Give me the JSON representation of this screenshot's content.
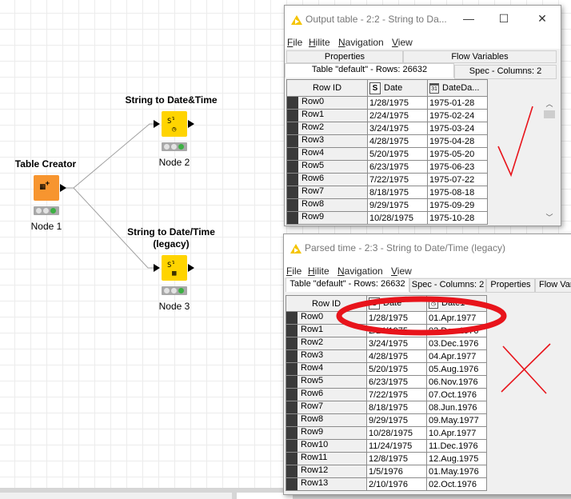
{
  "workflow": {
    "nodes": [
      {
        "id": "node1",
        "title": "Table Creator",
        "label": "Node 1",
        "color": "#f7952f",
        "icon": "table-plus-icon"
      },
      {
        "id": "node2",
        "title": "String to Date&Time",
        "label": "Node 2",
        "color": "#ffd400",
        "icon": "string-to-clock-icon"
      },
      {
        "id": "node3",
        "title_line1": "String to Date/Time",
        "title_line2": "(legacy)",
        "label": "Node 3",
        "color": "#ffd400",
        "icon": "string-to-calendar-icon"
      }
    ]
  },
  "window1": {
    "title": "Output table - 2:2 - String to Da...",
    "controls": {
      "minimize": "—",
      "maximize": "☐",
      "close": "✕"
    },
    "menu": [
      "File",
      "Hilite",
      "Navigation",
      "View"
    ],
    "tabs_row1": [
      "Properties",
      "Flow Variables"
    ],
    "tabs_row2": [
      "Table \"default\" - Rows: 26632",
      "Spec - Columns: 2"
    ],
    "columns": [
      {
        "name": "Row ID",
        "type": ""
      },
      {
        "name": "Date",
        "type": "S"
      },
      {
        "name": "DateDa...",
        "type": "31"
      }
    ],
    "rows": [
      [
        "Row0",
        "1/28/1975",
        "1975-01-28"
      ],
      [
        "Row1",
        "2/24/1975",
        "1975-02-24"
      ],
      [
        "Row2",
        "3/24/1975",
        "1975-03-24"
      ],
      [
        "Row3",
        "4/28/1975",
        "1975-04-28"
      ],
      [
        "Row4",
        "5/20/1975",
        "1975-05-20"
      ],
      [
        "Row5",
        "6/23/1975",
        "1975-06-23"
      ],
      [
        "Row6",
        "7/22/1975",
        "1975-07-22"
      ],
      [
        "Row7",
        "8/18/1975",
        "1975-08-18"
      ],
      [
        "Row8",
        "9/29/1975",
        "1975-09-29"
      ],
      [
        "Row9",
        "10/28/1975",
        "1975-10-28"
      ]
    ],
    "annotation": "checkmark"
  },
  "window2": {
    "title": "Parsed time - 2:3 - String to Date/Time (legacy)",
    "menu": [
      "File",
      "Hilite",
      "Navigation",
      "View"
    ],
    "tabs": [
      "Table \"default\" - Rows: 26632",
      "Spec - Columns: 2",
      "Properties",
      "Flow Var"
    ],
    "columns": [
      {
        "name": "Row ID",
        "type": ""
      },
      {
        "name": "Date",
        "type": "S"
      },
      {
        "name": "Date1",
        "type": "date-time"
      }
    ],
    "rows": [
      [
        "Row0",
        "1/28/1975",
        "01.Apr.1977"
      ],
      [
        "Row1",
        "2/24/1975",
        "02.Dec.1976"
      ],
      [
        "Row2",
        "3/24/1975",
        "03.Dec.1976"
      ],
      [
        "Row3",
        "4/28/1975",
        "04.Apr.1977"
      ],
      [
        "Row4",
        "5/20/1975",
        "05.Aug.1976"
      ],
      [
        "Row5",
        "6/23/1975",
        "06.Nov.1976"
      ],
      [
        "Row6",
        "7/22/1975",
        "07.Oct.1976"
      ],
      [
        "Row7",
        "8/18/1975",
        "08.Jun.1976"
      ],
      [
        "Row8",
        "9/29/1975",
        "09.May.1977"
      ],
      [
        "Row9",
        "10/28/1975",
        "10.Apr.1977"
      ],
      [
        "Row10",
        "11/24/1975",
        "11.Dec.1976"
      ],
      [
        "Row11",
        "12/8/1975",
        "12.Aug.1975"
      ],
      [
        "Row12",
        "1/5/1976",
        "01.May.1976"
      ],
      [
        "Row13",
        "2/10/1976",
        "02.Oct.1976"
      ]
    ],
    "annotations": [
      "red-ellipse-highlight",
      "cross-mark"
    ]
  },
  "colors": {
    "annotation_red": "#e8141b",
    "node_orange": "#f7952f",
    "node_yellow": "#ffd400",
    "status_green": "#3cb043"
  }
}
